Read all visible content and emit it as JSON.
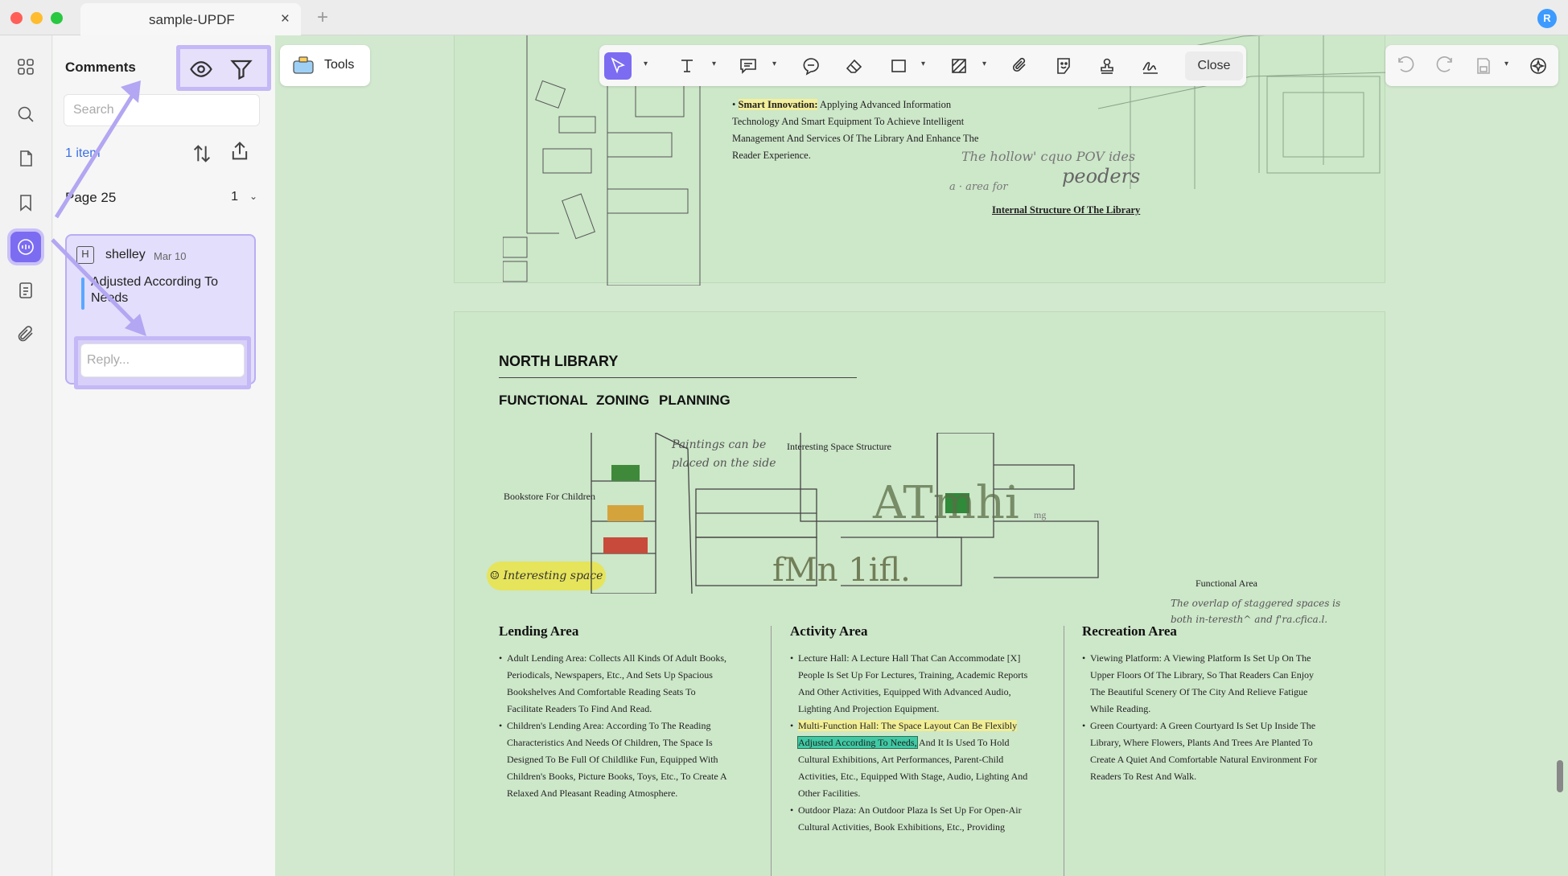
{
  "window": {
    "tab_title": "sample-UPDF",
    "tab_close": "×",
    "new_tab": "+",
    "user_initial": "R"
  },
  "rail": {
    "icons": [
      "thumbnails-icon",
      "search-icon",
      "pages-icon",
      "bookmark-icon",
      "comments-icon",
      "attachments-doc-icon",
      "paperclip-icon"
    ]
  },
  "comments_panel": {
    "title": "Comments",
    "search_placeholder": "Search",
    "items_count": "1 item",
    "page_label": "Page 25",
    "page_count": "1",
    "comment": {
      "author": "shelley",
      "date": "Mar 10",
      "text": "Adjusted According To Needs"
    },
    "reply_placeholder": "Reply..."
  },
  "toolbar": {
    "tools_label": "Tools",
    "close_label": "Close"
  },
  "document": {
    "top_page": {
      "bullet_highlight": "Smart Innovation:",
      "bullet_text": "Applying Advanced Information Technology And Smart Equipment To Achieve Intelligent Management And Services Of The Library And Enhance The Reader Experience.",
      "handwriting_1": "The hollow' cquo POV ides",
      "handwriting_2": "peoders",
      "handwriting_3": "a · area for",
      "caption": "Internal Structure Of The Library"
    },
    "main_page": {
      "title": "NORTH LIBRARY",
      "subtitle_words": [
        "FUNCTIONAL",
        "ZONING",
        "PLANNING"
      ],
      "labels": {
        "bookstore": "Bookstore For Children",
        "paintings_1": "Paintings can be",
        "paintings_2": "placed on the side",
        "interesting_structure": "Interesting Space Structure",
        "interesting_space": "☺ Interesting space",
        "functional_area": "Functional Area",
        "overlap_1": "The overlap of staggered spaces is",
        "overlap_2": "both in-teresth^ and f'ra.cfica.l.",
        "ocr_big_1": "ATmhi",
        "ocr_small_1": "mg",
        "ocr_big_2": "fMn 1ifl."
      },
      "columns": [
        {
          "title": "Lending Area",
          "items": [
            "Adult Lending Area: Collects All Kinds Of Adult Books, Periodicals, Newspapers, Etc., And Sets Up Spacious Bookshelves And Comfortable Reading Seats To Facilitate Readers To Find And Read.",
            "Children's Lending Area: According To The Reading Characteristics And Needs Of Children, The Space Is Designed To Be Full Of Childlike Fun, Equipped With Children's Books, Picture Books, Toys, Etc., To Create A Relaxed And Pleasant Reading Atmosphere."
          ]
        },
        {
          "title": "Activity Area",
          "items": [
            "Lecture Hall: A Lecture Hall That Can Accommodate [X] People Is Set Up For Lectures, Training, Academic Reports And Other Activities, Equipped With Advanced Audio, Lighting And Projection Equipment."
          ],
          "item2_highlight": "Multi-Function Hall: The Space Layout Can Be Flexibly",
          "item2_marked": "Adjusted According To Needs,",
          "item2_rest": "And It Is Used To Hold Cultural Exhibitions, Art Performances, Parent-Child Activities, Etc., Equipped With Stage, Audio, Lighting And Other Facilities.",
          "item3": "Outdoor Plaza: An Outdoor Plaza Is Set Up For Open-Air Cultural Activities, Book Exhibitions, Etc., Providing"
        },
        {
          "title": "Recreation Area",
          "items": [
            "Viewing Platform: A Viewing Platform Is Set Up On The Upper Floors Of The Library, So That Readers Can Enjoy The Beautiful Scenery Of The City And Relieve Fatigue While Reading.",
            "Green Courtyard: A Green Courtyard Is Set Up Inside The Library, Where Flowers, Plants And Trees Are Planted To Create A Quiet And Comfortable Natural Environment For Readers To Rest And Walk."
          ]
        }
      ]
    }
  },
  "colors": {
    "accent": "#7c6cf2",
    "annotation_outline": "#c4b8f6",
    "page_bg": "#cde7c9",
    "highlight_yellow": "#f1ee95",
    "highlight_teal": "#3fc9a4"
  }
}
